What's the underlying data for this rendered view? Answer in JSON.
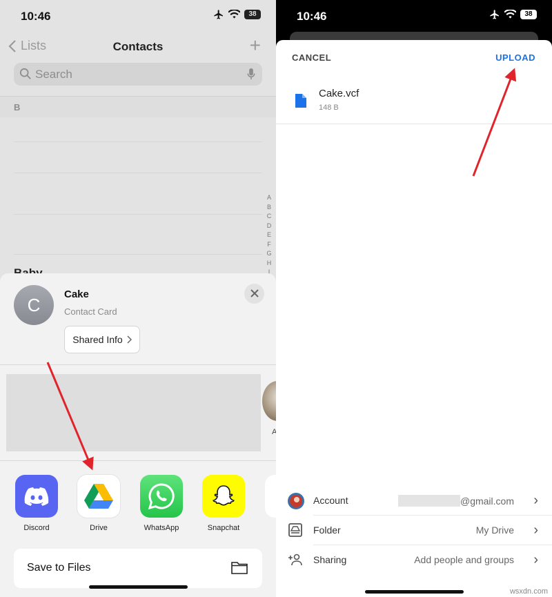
{
  "left": {
    "status": {
      "time": "10:46",
      "battery": "38"
    },
    "nav": {
      "back_label": "Lists",
      "title": "Contacts"
    },
    "search": {
      "placeholder": "Search"
    },
    "section_letter": "B",
    "index_letters": [
      "A",
      "B",
      "C",
      "D",
      "E",
      "F",
      "G",
      "H",
      "I"
    ],
    "peek_contact": "Baby",
    "share_sheet": {
      "avatar_initial": "C",
      "contact_name": "Cake",
      "contact_subtitle": "Contact Card",
      "shared_info_label": "Shared Info",
      "peek_person_initial": "A",
      "apps": [
        {
          "label": "Discord",
          "icon": "discord-icon",
          "color": "#5865F2"
        },
        {
          "label": "Drive",
          "icon": "google-drive-icon",
          "color": "#ffffff"
        },
        {
          "label": "WhatsApp",
          "icon": "whatsapp-icon",
          "color": "#25D366"
        },
        {
          "label": "Snapchat",
          "icon": "snapchat-icon",
          "color": "#FFFC00"
        }
      ],
      "save_to_files_label": "Save to Files"
    }
  },
  "right": {
    "status": {
      "time": "10:46",
      "battery": "38"
    },
    "header": {
      "cancel_label": "CANCEL",
      "upload_label": "UPLOAD"
    },
    "file": {
      "name": "Cake.vcf",
      "size": "148 B"
    },
    "settings": [
      {
        "label": "Account",
        "value": "@gmail.com",
        "icon": "account-avatar-icon"
      },
      {
        "label": "Folder",
        "value": "My Drive",
        "icon": "drive-folder-icon"
      },
      {
        "label": "Sharing",
        "value": "Add people and groups",
        "icon": "add-person-icon"
      }
    ],
    "watermark": "wsxdn.com"
  },
  "colors": {
    "upload_blue": "#1a73e8",
    "annotation_red": "#e0242c"
  }
}
